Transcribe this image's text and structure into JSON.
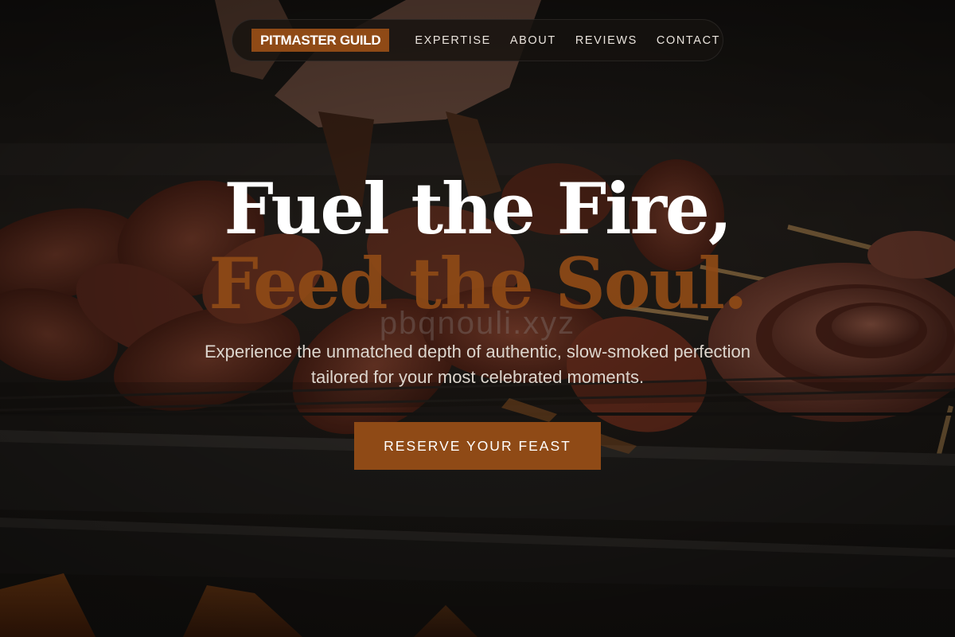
{
  "nav": {
    "brand": "PITMASTER GUILD",
    "links": [
      "EXPERTISE",
      "ABOUT",
      "REVIEWS",
      "CONTACT"
    ]
  },
  "hero": {
    "title_line1": "Fuel the Fire,",
    "title_line2": "Feed the Soul.",
    "watermark": "pbqnouli.xyz",
    "subtitle_line1": "Experience the unmatched depth of authentic, slow-smoked perfection",
    "subtitle_line2": "tailored for your most celebrated moments.",
    "cta_label": "RESERVE YOUR FEAST"
  },
  "colors": {
    "accent": "#8f4a16",
    "title": "#ffffff",
    "text": "#ddd6ce",
    "nav_bg": "#16120f"
  }
}
